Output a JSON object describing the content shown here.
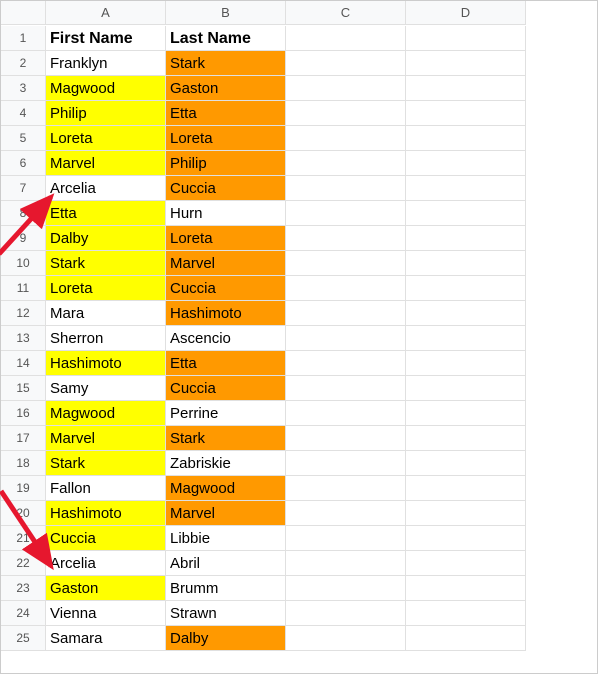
{
  "columns": [
    "A",
    "B",
    "C",
    "D"
  ],
  "header_row": {
    "a": "First Name",
    "b": "Last Name"
  },
  "rows": [
    {
      "n": 2,
      "a": "Franklyn",
      "ah": "",
      "b": "Stark",
      "bh": "orange"
    },
    {
      "n": 3,
      "a": "Magwood",
      "ah": "yellow",
      "b": "Gaston",
      "bh": "orange"
    },
    {
      "n": 4,
      "a": "Philip",
      "ah": "yellow",
      "b": "Etta",
      "bh": "orange"
    },
    {
      "n": 5,
      "a": "Loreta",
      "ah": "yellow",
      "b": "Loreta",
      "bh": "orange"
    },
    {
      "n": 6,
      "a": "Marvel",
      "ah": "yellow",
      "b": "Philip",
      "bh": "orange"
    },
    {
      "n": 7,
      "a": "Arcelia",
      "ah": "",
      "b": "Cuccia",
      "bh": "orange"
    },
    {
      "n": 8,
      "a": "Etta",
      "ah": "yellow",
      "b": "Hurn",
      "bh": ""
    },
    {
      "n": 9,
      "a": "Dalby",
      "ah": "yellow",
      "b": "Loreta",
      "bh": "orange"
    },
    {
      "n": 10,
      "a": "Stark",
      "ah": "yellow",
      "b": "Marvel",
      "bh": "orange"
    },
    {
      "n": 11,
      "a": "Loreta",
      "ah": "yellow",
      "b": "Cuccia",
      "bh": "orange"
    },
    {
      "n": 12,
      "a": "Mara",
      "ah": "",
      "b": "Hashimoto",
      "bh": "orange"
    },
    {
      "n": 13,
      "a": "Sherron",
      "ah": "",
      "b": "Ascencio",
      "bh": ""
    },
    {
      "n": 14,
      "a": "Hashimoto",
      "ah": "yellow",
      "b": "Etta",
      "bh": "orange"
    },
    {
      "n": 15,
      "a": "Samy",
      "ah": "",
      "b": "Cuccia",
      "bh": "orange"
    },
    {
      "n": 16,
      "a": "Magwood",
      "ah": "yellow",
      "b": "Perrine",
      "bh": ""
    },
    {
      "n": 17,
      "a": "Marvel",
      "ah": "yellow",
      "b": "Stark",
      "bh": "orange"
    },
    {
      "n": 18,
      "a": "Stark",
      "ah": "yellow",
      "b": "Zabriskie",
      "bh": ""
    },
    {
      "n": 19,
      "a": "Fallon",
      "ah": "",
      "b": "Magwood",
      "bh": "orange"
    },
    {
      "n": 20,
      "a": "Hashimoto",
      "ah": "yellow",
      "b": "Marvel",
      "bh": "orange"
    },
    {
      "n": 21,
      "a": "Cuccia",
      "ah": "yellow",
      "b": "Libbie",
      "bh": ""
    },
    {
      "n": 22,
      "a": "Arcelia",
      "ah": "",
      "b": "Abril",
      "bh": ""
    },
    {
      "n": 23,
      "a": "Gaston",
      "ah": "yellow",
      "b": "Brumm",
      "bh": ""
    },
    {
      "n": 24,
      "a": "Vienna",
      "ah": "",
      "b": "Strawn",
      "bh": ""
    },
    {
      "n": 25,
      "a": "Samara",
      "ah": "",
      "b": "Dalby",
      "bh": "orange"
    }
  ],
  "annotations": {
    "arrow1_target_row": 7,
    "arrow2_target_row": 22
  }
}
